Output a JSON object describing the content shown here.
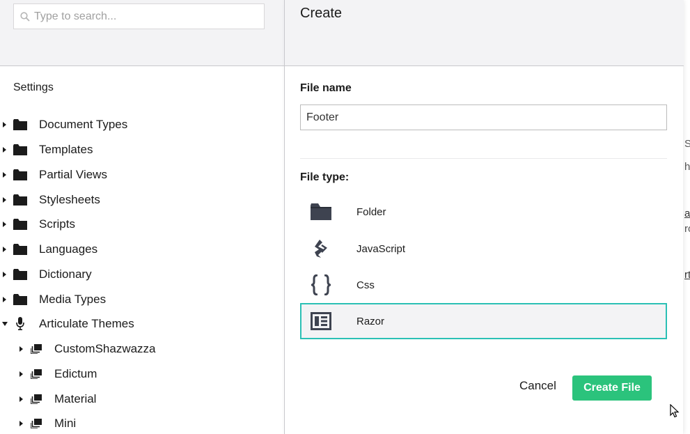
{
  "search": {
    "placeholder": "Type to search..."
  },
  "tree": {
    "section_title": "Settings",
    "items": [
      {
        "label": "Document Types",
        "icon": "folder-icon",
        "expanded": false
      },
      {
        "label": "Templates",
        "icon": "folder-icon",
        "expanded": false
      },
      {
        "label": "Partial Views",
        "icon": "folder-icon",
        "expanded": false
      },
      {
        "label": "Stylesheets",
        "icon": "folder-icon",
        "expanded": false
      },
      {
        "label": "Scripts",
        "icon": "folder-icon",
        "expanded": false
      },
      {
        "label": "Languages",
        "icon": "folder-icon",
        "expanded": false
      },
      {
        "label": "Dictionary",
        "icon": "folder-icon",
        "expanded": false
      },
      {
        "label": "Media Types",
        "icon": "folder-icon",
        "expanded": false
      },
      {
        "label": "Articulate Themes",
        "icon": "microphone-icon",
        "expanded": true
      }
    ],
    "children": [
      {
        "label": "CustomShazwazza",
        "icon": "layers-icon"
      },
      {
        "label": "Edictum",
        "icon": "layers-icon"
      },
      {
        "label": "Material",
        "icon": "layers-icon"
      },
      {
        "label": "Mini",
        "icon": "layers-icon"
      }
    ]
  },
  "dialog": {
    "title": "Create",
    "file_name_label": "File name",
    "file_name_value": "Footer",
    "file_type_label": "File type:",
    "types": [
      {
        "label": "Folder",
        "icon": "folder-icon",
        "selected": false
      },
      {
        "label": "JavaScript",
        "icon": "javascript-icon",
        "selected": false
      },
      {
        "label": "Css",
        "icon": "curly-braces-icon",
        "selected": false
      },
      {
        "label": "Razor",
        "icon": "newspaper-icon",
        "selected": true
      }
    ],
    "cancel_label": "Cancel",
    "create_label": "Create File"
  },
  "background_fragments": [
    "S",
    "he",
    "at",
    "ro",
    "rt"
  ],
  "colors": {
    "accent_teal": "#2bc0b5",
    "create_green": "#2bc37c",
    "header_gray": "#f3f3f5"
  }
}
